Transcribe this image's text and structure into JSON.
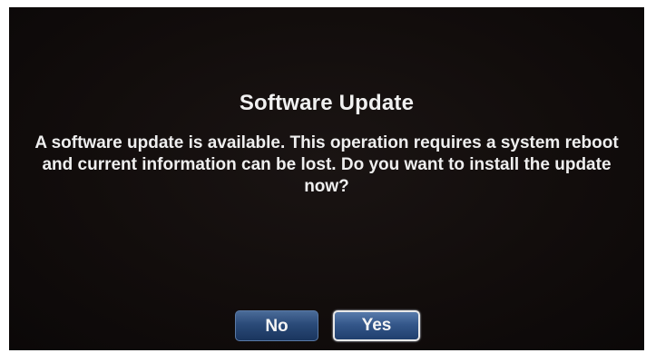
{
  "dialog": {
    "title": "Software Update",
    "message": "A software update is available. This operation requires a system reboot and current information can be lost. Do you want to install the update now?",
    "buttons": {
      "no_label": "No",
      "yes_label": "Yes"
    },
    "focused_button": "Yes"
  },
  "colors": {
    "screen_background": "#120d0c",
    "text": "#f1f1f1",
    "button_blue": "#2a4a78",
    "focus_border": "#e8e8e8"
  }
}
